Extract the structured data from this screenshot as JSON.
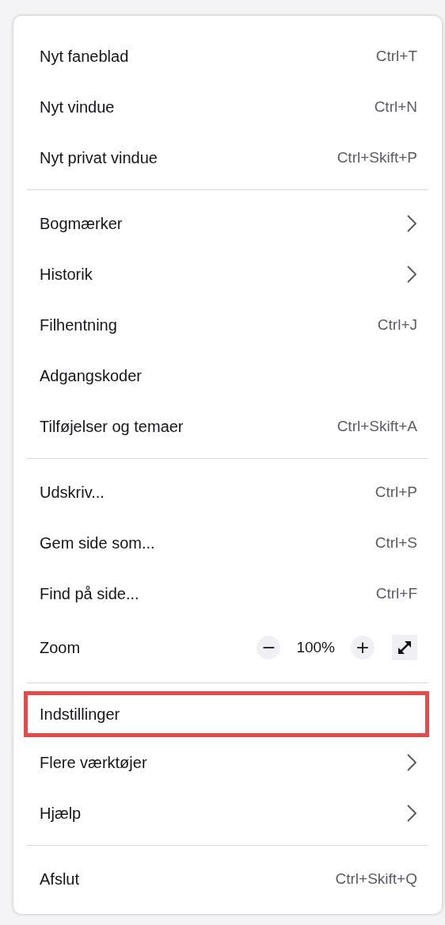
{
  "menu": {
    "sections": [
      {
        "items": [
          {
            "kind": "item",
            "label": "Nyt faneblad",
            "shortcut": "Ctrl+T",
            "submenu": false,
            "highlighted": false
          },
          {
            "kind": "item",
            "label": "Nyt vindue",
            "shortcut": "Ctrl+N",
            "submenu": false,
            "highlighted": false
          },
          {
            "kind": "item",
            "label": "Nyt privat vindue",
            "shortcut": "Ctrl+Skift+P",
            "submenu": false,
            "highlighted": false
          }
        ]
      },
      {
        "items": [
          {
            "kind": "item",
            "label": "Bogmærker",
            "submenu": true,
            "highlighted": false
          },
          {
            "kind": "item",
            "label": "Historik",
            "submenu": true,
            "highlighted": false
          },
          {
            "kind": "item",
            "label": "Filhentning",
            "shortcut": "Ctrl+J",
            "submenu": false,
            "highlighted": false
          },
          {
            "kind": "item",
            "label": "Adgangskoder",
            "submenu": false,
            "highlighted": false
          },
          {
            "kind": "item",
            "label": "Tilføjelser og temaer",
            "shortcut": "Ctrl+Skift+A",
            "submenu": false,
            "highlighted": false
          }
        ]
      },
      {
        "items": [
          {
            "kind": "item",
            "label": "Udskriv...",
            "shortcut": "Ctrl+P",
            "submenu": false,
            "highlighted": false
          },
          {
            "kind": "item",
            "label": "Gem side som...",
            "shortcut": "Ctrl+S",
            "submenu": false,
            "highlighted": false
          },
          {
            "kind": "item",
            "label": "Find på side...",
            "shortcut": "Ctrl+F",
            "submenu": false,
            "highlighted": false
          },
          {
            "kind": "zoom",
            "label": "Zoom",
            "minus": "−",
            "value": "100%",
            "plus": "+"
          }
        ]
      },
      {
        "items": [
          {
            "kind": "item",
            "label": "Indstillinger",
            "submenu": false,
            "highlighted": true
          },
          {
            "kind": "item",
            "label": "Flere værktøjer",
            "submenu": true,
            "highlighted": false
          },
          {
            "kind": "item",
            "label": "Hjælp",
            "submenu": true,
            "highlighted": false
          }
        ]
      },
      {
        "items": [
          {
            "kind": "item",
            "label": "Afslut",
            "shortcut": "Ctrl+Skift+Q",
            "submenu": false,
            "highlighted": false
          }
        ]
      }
    ]
  }
}
